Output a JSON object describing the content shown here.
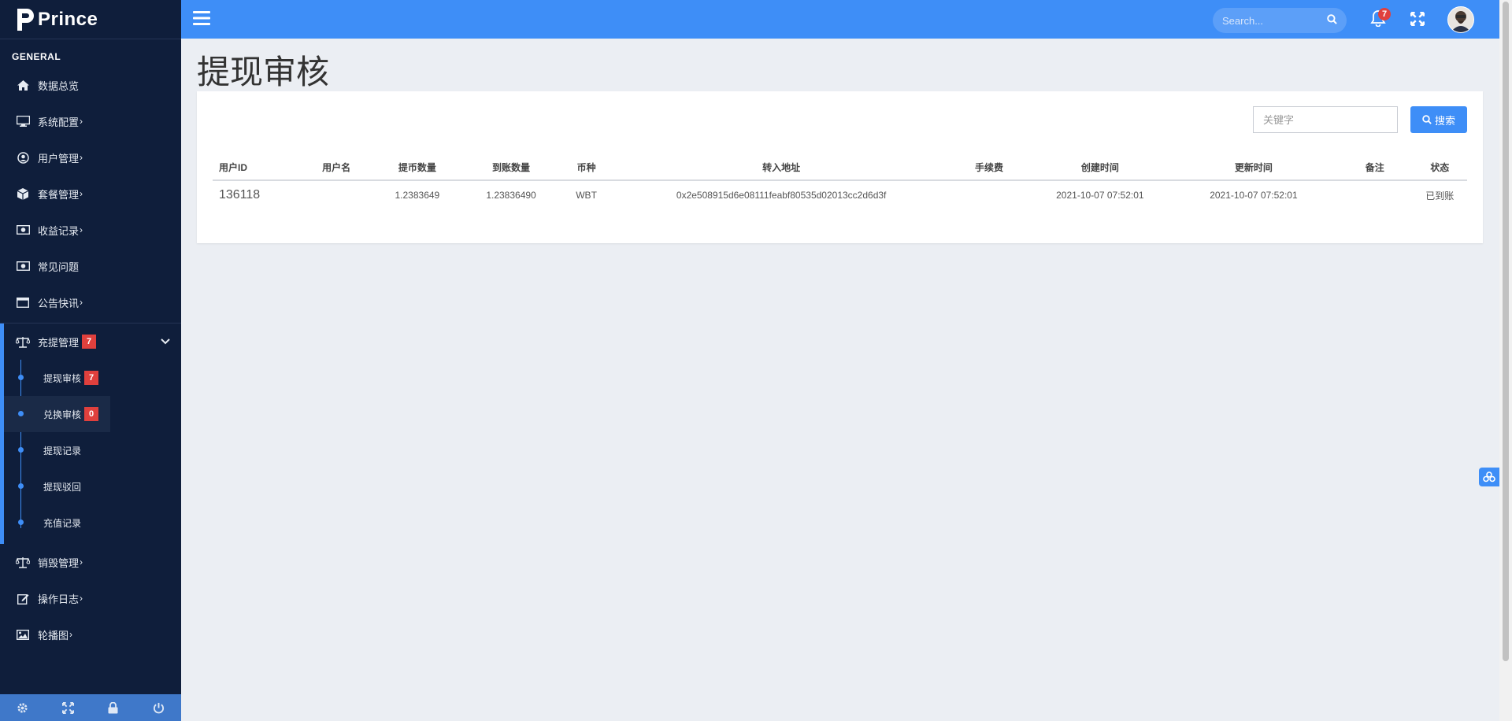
{
  "brand": {
    "name": "Prince"
  },
  "sidebar": {
    "section_label": "GENERAL",
    "items": [
      {
        "label": "数据总览",
        "icon": "home-icon",
        "chevron": ""
      },
      {
        "label": "系统配置",
        "icon": "monitor-icon",
        "chevron": "›"
      },
      {
        "label": "用户管理",
        "icon": "user-circle-icon",
        "chevron": "›"
      },
      {
        "label": "套餐管理",
        "icon": "cube-icon",
        "chevron": "›"
      },
      {
        "label": "收益记录",
        "icon": "money-icon",
        "chevron": "›"
      },
      {
        "label": "常见问题",
        "icon": "money-icon",
        "chevron": ""
      },
      {
        "label": "公告快讯",
        "icon": "window-icon",
        "chevron": "›"
      }
    ],
    "group": {
      "label": "充提管理",
      "badge": "7",
      "icon": "balance-scale-icon",
      "sub_items": [
        {
          "label": "提现审核",
          "badge": "7"
        },
        {
          "label": "兑换审核",
          "badge": "0"
        },
        {
          "label": "提现记录",
          "badge": ""
        },
        {
          "label": "提现驳回",
          "badge": ""
        },
        {
          "label": "充值记录",
          "badge": ""
        }
      ]
    },
    "items_after": [
      {
        "label": "销毁管理",
        "icon": "balance-scale-icon",
        "chevron": "›"
      },
      {
        "label": "操作日志",
        "icon": "edit-icon",
        "chevron": "›"
      },
      {
        "label": "轮播图",
        "icon": "image-icon",
        "chevron": "›"
      }
    ],
    "footer_icons": [
      "gear-icon",
      "expand-icon",
      "lock-icon",
      "power-icon"
    ]
  },
  "topbar": {
    "search_placeholder": "Search...",
    "notification_count": "7"
  },
  "page": {
    "title": "提现审核",
    "keyword_placeholder": "关键字",
    "search_button": "搜索"
  },
  "table": {
    "headers": [
      "用户ID",
      "用户名",
      "提币数量",
      "到账数量",
      "币种",
      "转入地址",
      "手续费",
      "创建时间",
      "更新时间",
      "备注",
      "状态"
    ],
    "rows": [
      {
        "user_id": "136118",
        "username": "",
        "withdraw_amount": "1.2383649",
        "received_amount": "1.23836490",
        "currency": "WBT",
        "address": "0x2e508915d6e08111feabf80535d02013cc2d6d3f",
        "fee": "",
        "created_at": "2021-10-07 07:52:01",
        "updated_at": "2021-10-07 07:52:01",
        "remark": "",
        "status": "已到账"
      }
    ]
  },
  "colors": {
    "primary": "#3e8ef7",
    "sidebar_bg": "#0f1e3b",
    "badge": "#e0403d",
    "page_bg": "#ebeef3"
  }
}
